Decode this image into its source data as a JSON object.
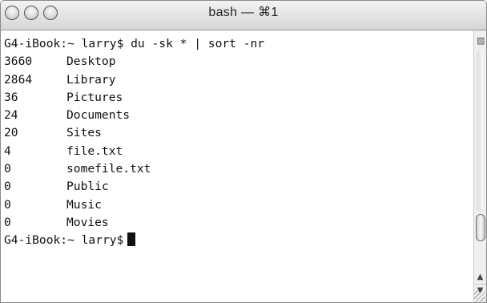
{
  "window": {
    "title": "bash — ⌘1",
    "buttons": [
      "close-button",
      "minimize-button",
      "zoom-button"
    ]
  },
  "terminal": {
    "command_line": "G4-iBook:~ larry$ du -sk * | sort -nr",
    "rows": [
      {
        "size": "3660",
        "name": "Desktop"
      },
      {
        "size": "2864",
        "name": "Library"
      },
      {
        "size": "36",
        "name": "Pictures"
      },
      {
        "size": "24",
        "name": "Documents"
      },
      {
        "size": "20",
        "name": "Sites"
      },
      {
        "size": "4",
        "name": "file.txt"
      },
      {
        "size": "0",
        "name": "somefile.txt"
      },
      {
        "size": "0",
        "name": "Public"
      },
      {
        "size": "0",
        "name": "Music"
      },
      {
        "size": "0",
        "name": "Movies"
      }
    ],
    "prompt": "G4-iBook:~ larry$"
  },
  "scrollbar": {
    "split_icon": "split-pane-icon",
    "up_icon": "▲",
    "down_icon": "▼"
  }
}
